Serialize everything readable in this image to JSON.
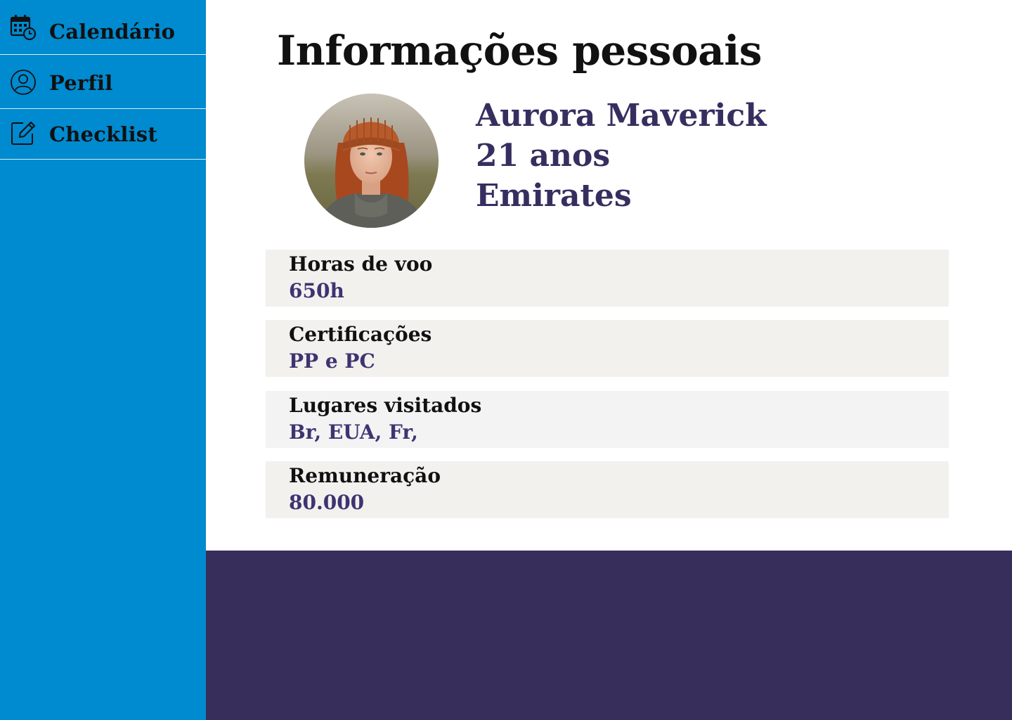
{
  "sidebar": {
    "items": [
      {
        "label": "Calendário",
        "icon": "calendar-clock-icon"
      },
      {
        "label": "Perfil",
        "icon": "user-circle-icon"
      },
      {
        "label": "Checklist",
        "icon": "edit-icon"
      }
    ]
  },
  "main": {
    "title": "Informações pessoais",
    "profile": {
      "name": "Aurora Maverick",
      "age": "21 anos",
      "airline": "Emirates"
    },
    "cards": [
      {
        "label": "Horas de voo",
        "value": "650h"
      },
      {
        "label": "Certificações",
        "value": "PP e PC"
      },
      {
        "label": "Lugares visitados",
        "value": "Br, EUA, Fr,"
      },
      {
        "label": "Remuneração",
        "value": "80.000"
      }
    ]
  },
  "colors": {
    "sidebar": "#008ACF",
    "accent_text": "#372E60",
    "footer": "#372E5C",
    "card": "#F2F1EE"
  }
}
